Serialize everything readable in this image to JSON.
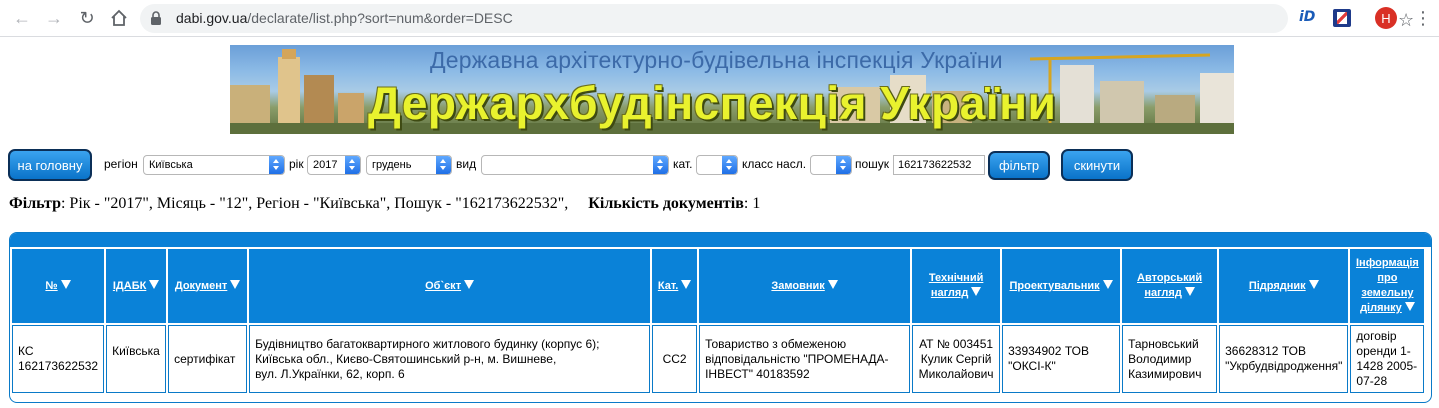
{
  "browser": {
    "url_host": "dabi.gov.ua",
    "url_path": "/declarate/list.php?sort=num&order=DESC",
    "extension_label": "iD",
    "profile_initial": "H"
  },
  "banner": {
    "subtitle": "Державна архітектурно-будівельна інспекція України",
    "title": "Держархбудінспекція України"
  },
  "toolbar": {
    "home_button": "на головну",
    "region_label": "регіон",
    "region_value": "Київська",
    "year_label": "рік",
    "year_value": "2017",
    "month_value": "грудень",
    "type_label": "вид",
    "type_value": "",
    "category_label": "кат.",
    "category_value": "",
    "class_label": "класс насл.",
    "class_value": "",
    "search_label": "пошук",
    "search_value": "162173622532",
    "filter_button": "фільтр",
    "reset_button": "скинути"
  },
  "summary": {
    "filter_label": "Фільтр",
    "filter_text": ": Рік - \"2017\", Місяць - \"12\", Регіон - \"Київська\", Пошук - \"162173622532\",",
    "count_label": "Кількість документів",
    "count_value": ": 1"
  },
  "table": {
    "headers": [
      {
        "text": "№"
      },
      {
        "text": "ІДАБК"
      },
      {
        "text": "Документ"
      },
      {
        "text": "Об`єкт"
      },
      {
        "text": "Кат."
      },
      {
        "text": "Замовник"
      },
      {
        "line1": "Технічний",
        "line2": "нагляд"
      },
      {
        "text": "Проектувальник"
      },
      {
        "line1": "Авторський",
        "line2": "нагляд"
      },
      {
        "text": "Підрядник"
      },
      {
        "line1": "Інформація",
        "line2": "про",
        "line3": "земельну",
        "line4": "ділянку"
      }
    ],
    "row": {
      "num_1": "КС",
      "num_2": "162173622532",
      "idabk": "Київська",
      "document": "сертифікат",
      "object_1": "Будівництво багатоквартирного житлового будинку (корпус 6);",
      "object_2": "Київська обл., Києво-Святошинський р-н, м. Вишневе,",
      "object_3": "вул. Л.Українки, 62, корп. 6",
      "category": "СС2",
      "customer_1": "Товариство з обмеженою",
      "customer_2": "відповідальністю \"ПРОМЕНАДА-",
      "customer_3": "ІНВЕСТ\" 40183592",
      "tech_1": "АТ № 003451",
      "tech_2": "Кулик Сергій",
      "tech_3": "Миколайович",
      "designer_1": "33934902 ТОВ",
      "designer_2": "\"ОКСІ-К\"",
      "author_1": "Тарновський",
      "author_2": "Володимир",
      "author_3": "Казимирович",
      "contractor_1": "36628312 ТОВ",
      "contractor_2": "\"Укрбудвідродження\"",
      "land_1": "договір",
      "land_2": "оренди 1-",
      "land_3": "1428 2005-",
      "land_4": "07-28"
    }
  },
  "colors": {
    "accent": "#0a82d8",
    "button_border": "#0b2f57",
    "banner_title": "#e9f22e"
  }
}
